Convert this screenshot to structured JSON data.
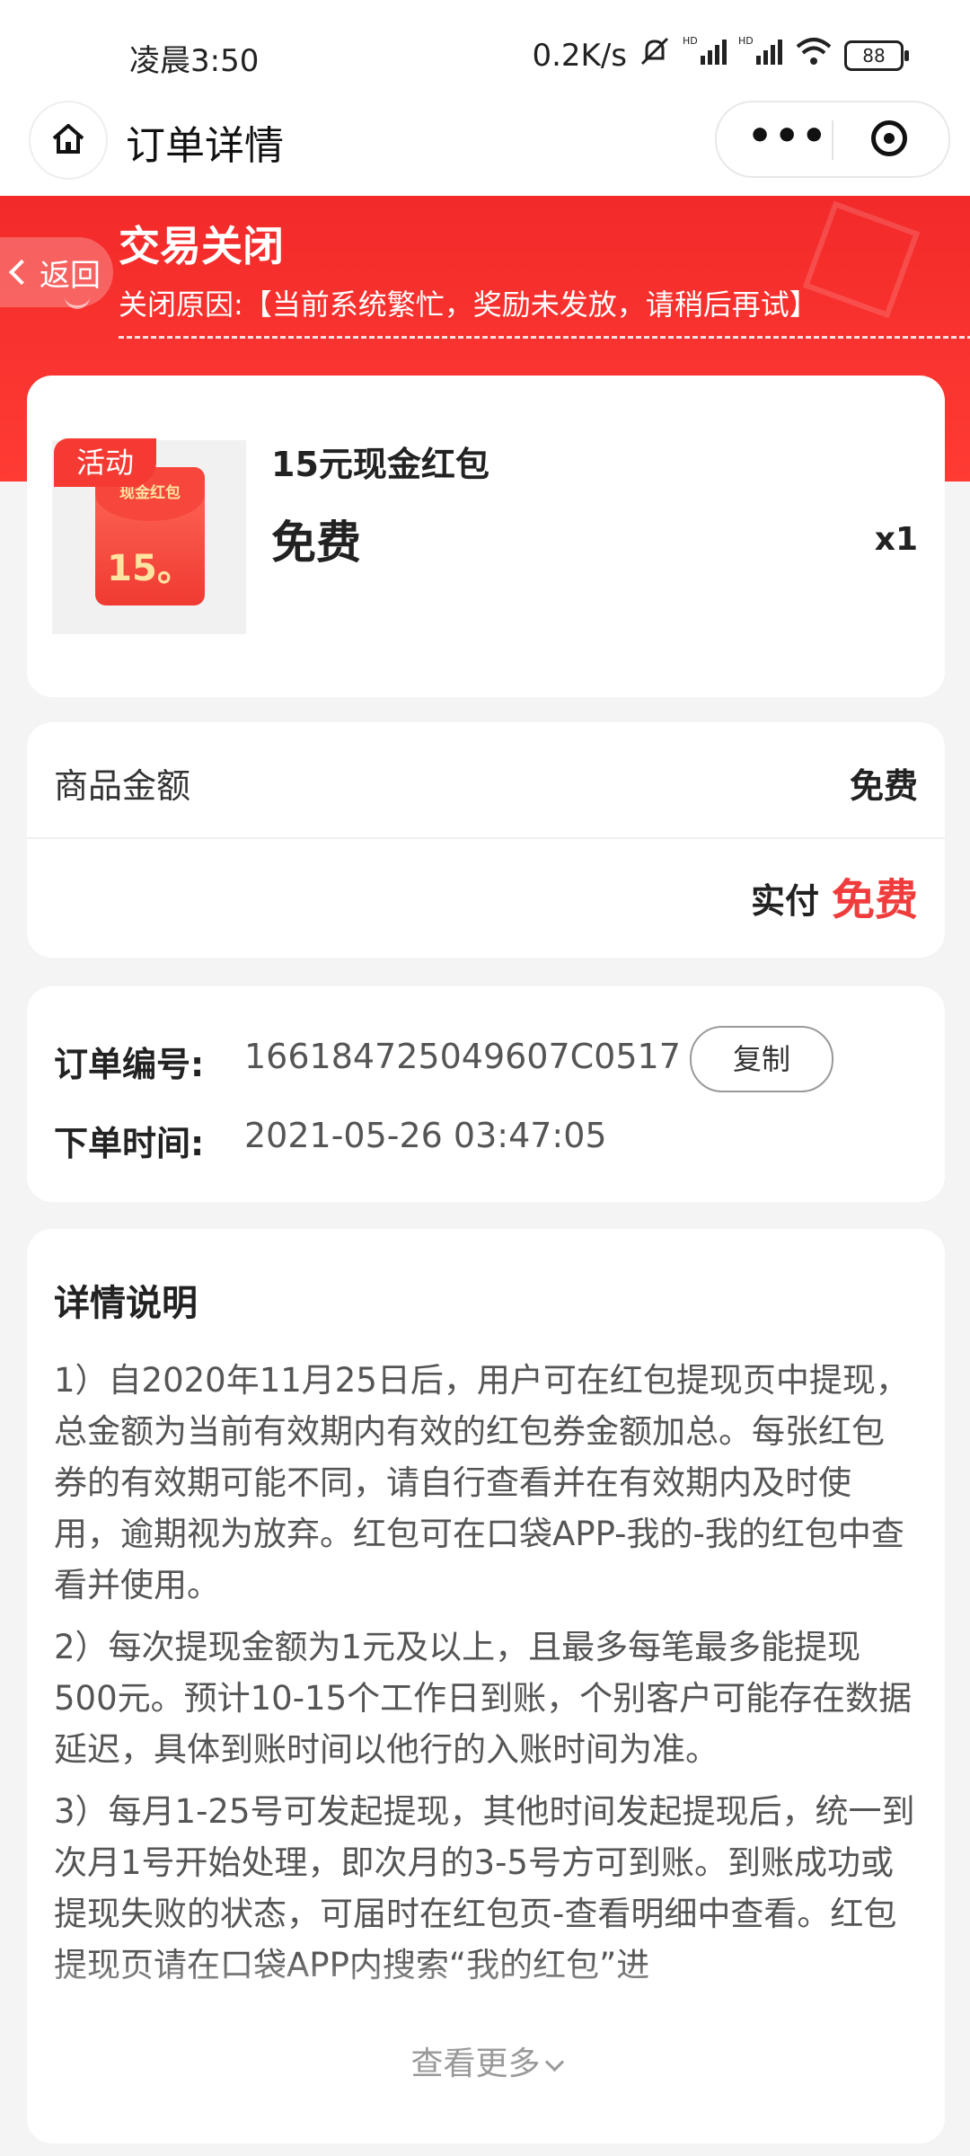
{
  "status_bar": {
    "time": "凌晨3:50",
    "net_speed": "0.2K/s",
    "signal1_label": "HD",
    "signal2_label": "HD",
    "battery": "88"
  },
  "nav": {
    "title": "订单详情"
  },
  "header": {
    "back_label": "返回",
    "status": "交易关闭",
    "close_reason": "关闭原因:【当前系统繁忙，奖励未发放，请稍后再试】"
  },
  "product": {
    "badge": "活动",
    "image_label": "现金红包",
    "image_amount": "15。",
    "name": "15元现金红包",
    "price": "免费",
    "qty": "x1"
  },
  "amount": {
    "label": "商品金额",
    "value": "免费",
    "paid_label": "实付",
    "paid_value": "免费"
  },
  "order": {
    "no_label": "订单编号:",
    "no_value": "166184725049607C0517",
    "copy_label": "复制",
    "time_label": "下单时间:",
    "time_value": "2021-05-26 03:47:05"
  },
  "detail": {
    "title": "详情说明",
    "paragraphs": [
      "1）自2020年11月25日后，用户可在红包提现页中提现，总金额为当前有效期内有效的红包券金额加总。每张红包券的有效期可能不同，请自行查看并在有效期内及时使用，逾期视为放弃。红包可在口袋APP-我的-我的红包中查看并使用。",
      "2）每次提现金额为1元及以上，且最多每笔最多能提现500元。预计10-15个工作日到账，个别客户可能存在数据延迟，具体到账时间以他行的入账时间为准。",
      "3）每月1-25号可发起提现，其他时间发起提现后，统一到次月1号开始处理，即次月的3-5号方可到账。到账成功或提现失败的状态，可届时在红包页-查看明细中查看。红包提现页请在口袋APP内搜索“我的红包”进"
    ],
    "view_more": "查看更多"
  }
}
